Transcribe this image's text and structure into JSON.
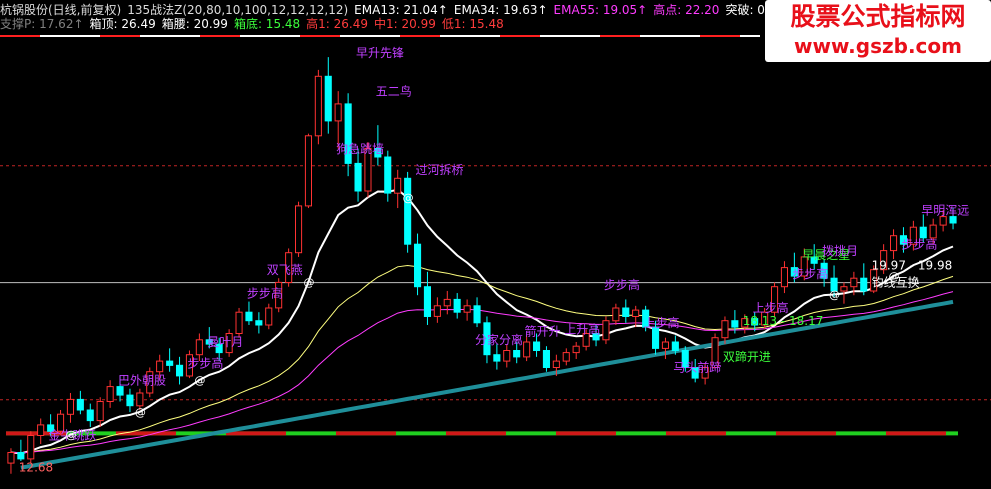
{
  "header": {
    "row1": [
      {
        "text": "杭锅股份(日线,前复权)",
        "color": "#dcdcdc"
      },
      {
        "text": "135战法Z(20,80,10,100,12,12,12,12)",
        "color": "#dcdcdc"
      },
      {
        "text": "EMA13: 21.04↑",
        "color": "#ffffff"
      },
      {
        "text": "EMA34: 19.63↑",
        "color": "#ffffff"
      },
      {
        "text": "EMA55: 19.05↑",
        "color": "#ff3cff"
      },
      {
        "text": "高点: 22.20",
        "color": "#ff3cff"
      },
      {
        "text": "突破: 0.00",
        "color": "#ffffff"
      }
    ],
    "row2": [
      {
        "text": "支撑P: 17.62↑",
        "color": "#808080"
      },
      {
        "text": "箱顶: 26.49",
        "color": "#ffffff"
      },
      {
        "text": "箱腰: 20.99",
        "color": "#ffffff"
      },
      {
        "text": "箱底: 15.48",
        "color": "#3cff3c"
      },
      {
        "text": "高1: 26.49",
        "color": "#ff3c3c"
      },
      {
        "text": "中1: 20.99",
        "color": "#ff3c3c"
      },
      {
        "text": "低1: 15.48",
        "color": "#ff3c3c"
      }
    ]
  },
  "watermark": {
    "line1": "股票公式指标网",
    "line2": "www.gszb.com"
  },
  "colors": {
    "up": "#ff3232",
    "down": "#00ffff",
    "ema13": "#ffffff",
    "ema34": "#ffff80",
    "ema55": "#ff3cff",
    "long": "#1f8f9a",
    "label": "#c040ff",
    "label_alt": "#ffff00"
  },
  "chart_data": {
    "type": "candlestick",
    "ylim": [
      11.8,
      32.5
    ],
    "x_count": 96,
    "ohlc": [
      [
        12.5,
        13.2,
        12.0,
        13.0
      ],
      [
        13.0,
        13.6,
        12.6,
        12.7
      ],
      [
        12.7,
        14.0,
        12.5,
        13.8
      ],
      [
        13.8,
        14.6,
        13.4,
        14.3
      ],
      [
        14.3,
        14.8,
        13.8,
        14.0
      ],
      [
        14.0,
        15.0,
        13.8,
        14.8
      ],
      [
        14.8,
        15.8,
        14.4,
        15.5
      ],
      [
        15.5,
        15.9,
        14.8,
        15.0
      ],
      [
        15.0,
        15.3,
        14.2,
        14.5
      ],
      [
        14.5,
        15.6,
        14.2,
        15.4
      ],
      [
        15.4,
        16.4,
        15.1,
        16.1
      ],
      [
        16.1,
        16.6,
        15.4,
        15.7
      ],
      [
        15.7,
        16.0,
        14.9,
        15.2
      ],
      [
        15.2,
        16.0,
        15.0,
        15.8
      ],
      [
        15.8,
        17.0,
        15.6,
        16.8
      ],
      [
        16.8,
        17.6,
        16.4,
        17.3
      ],
      [
        17.3,
        17.9,
        16.8,
        17.1
      ],
      [
        17.1,
        17.5,
        16.2,
        16.6
      ],
      [
        16.6,
        17.8,
        16.5,
        17.6
      ],
      [
        17.6,
        18.6,
        17.3,
        18.3
      ],
      [
        18.3,
        18.9,
        17.9,
        18.1
      ],
      [
        18.1,
        18.4,
        17.3,
        17.7
      ],
      [
        17.7,
        18.8,
        17.5,
        18.6
      ],
      [
        18.6,
        19.8,
        18.4,
        19.6
      ],
      [
        19.6,
        20.1,
        19.0,
        19.2
      ],
      [
        19.2,
        19.6,
        18.6,
        19.0
      ],
      [
        19.0,
        20.0,
        18.8,
        19.8
      ],
      [
        19.8,
        21.2,
        19.6,
        21.0
      ],
      [
        21.0,
        22.6,
        20.8,
        22.4
      ],
      [
        22.4,
        24.8,
        22.2,
        24.6
      ],
      [
        24.6,
        28.0,
        24.5,
        27.9
      ],
      [
        27.9,
        31.0,
        27.5,
        30.7
      ],
      [
        30.7,
        31.6,
        28.0,
        28.6
      ],
      [
        28.6,
        30.0,
        27.3,
        29.4
      ],
      [
        29.4,
        29.9,
        26.0,
        26.6
      ],
      [
        26.6,
        27.3,
        24.8,
        25.3
      ],
      [
        25.3,
        27.6,
        25.0,
        27.3
      ],
      [
        27.3,
        28.4,
        26.5,
        26.9
      ],
      [
        26.9,
        27.2,
        24.8,
        25.2
      ],
      [
        25.2,
        26.3,
        24.5,
        25.9
      ],
      [
        25.9,
        26.2,
        22.4,
        22.8
      ],
      [
        22.8,
        23.3,
        20.4,
        20.8
      ],
      [
        20.8,
        21.5,
        19.0,
        19.4
      ],
      [
        19.4,
        20.3,
        19.1,
        19.9
      ],
      [
        19.9,
        20.6,
        19.5,
        20.2
      ],
      [
        20.2,
        20.5,
        19.3,
        19.6
      ],
      [
        19.6,
        20.2,
        19.2,
        19.9
      ],
      [
        19.9,
        20.3,
        18.9,
        19.1
      ],
      [
        19.1,
        19.4,
        17.2,
        17.6
      ],
      [
        17.6,
        18.1,
        16.9,
        17.3
      ],
      [
        17.3,
        18.1,
        17.0,
        17.8
      ],
      [
        17.8,
        18.2,
        17.2,
        17.5
      ],
      [
        17.5,
        18.5,
        17.3,
        18.2
      ],
      [
        18.2,
        18.6,
        17.5,
        17.8
      ],
      [
        17.8,
        18.0,
        16.8,
        17.0
      ],
      [
        17.0,
        17.6,
        16.6,
        17.3
      ],
      [
        17.3,
        17.9,
        17.1,
        17.7
      ],
      [
        17.7,
        18.2,
        17.4,
        18.0
      ],
      [
        18.0,
        18.8,
        17.8,
        18.6
      ],
      [
        18.6,
        19.0,
        18.0,
        18.3
      ],
      [
        18.3,
        19.4,
        18.1,
        19.2
      ],
      [
        19.2,
        20.0,
        19.0,
        19.8
      ],
      [
        19.8,
        20.2,
        19.1,
        19.4
      ],
      [
        19.4,
        19.9,
        18.9,
        19.7
      ],
      [
        19.7,
        19.9,
        18.7,
        18.9
      ],
      [
        18.9,
        19.2,
        17.6,
        17.9
      ],
      [
        17.9,
        18.4,
        17.4,
        18.2
      ],
      [
        18.2,
        18.5,
        17.6,
        17.8
      ],
      [
        17.8,
        18.0,
        16.8,
        17.0
      ],
      [
        17.0,
        17.4,
        16.3,
        16.5
      ],
      [
        16.5,
        17.2,
        16.2,
        17.0
      ],
      [
        17.0,
        18.6,
        16.9,
        18.4
      ],
      [
        18.4,
        19.4,
        18.1,
        19.2
      ],
      [
        19.2,
        19.7,
        18.6,
        18.9
      ],
      [
        18.9,
        19.5,
        18.6,
        19.3
      ],
      [
        19.3,
        19.6,
        18.7,
        19.0
      ],
      [
        19.0,
        19.8,
        18.8,
        19.6
      ],
      [
        19.6,
        21.0,
        19.4,
        20.8
      ],
      [
        20.8,
        22.0,
        20.5,
        21.7
      ],
      [
        21.7,
        22.4,
        21.0,
        21.3
      ],
      [
        21.3,
        22.6,
        21.1,
        22.2
      ],
      [
        22.2,
        22.8,
        21.6,
        21.9
      ],
      [
        21.9,
        22.1,
        20.8,
        21.2
      ],
      [
        21.2,
        21.8,
        20.3,
        20.6
      ],
      [
        20.6,
        21.0,
        20.0,
        20.8
      ],
      [
        20.8,
        21.5,
        20.4,
        21.2
      ],
      [
        21.2,
        21.9,
        20.4,
        20.6
      ],
      [
        20.6,
        21.8,
        20.5,
        21.6
      ],
      [
        21.6,
        22.8,
        21.4,
        22.5
      ],
      [
        22.5,
        23.5,
        22.1,
        23.2
      ],
      [
        23.2,
        23.6,
        22.4,
        22.8
      ],
      [
        22.8,
        23.9,
        22.5,
        23.6
      ],
      [
        23.6,
        24.2,
        22.9,
        23.1
      ],
      [
        23.1,
        24.0,
        22.8,
        23.7
      ],
      [
        23.7,
        24.4,
        23.4,
        24.1
      ],
      [
        24.1,
        24.5,
        23.5,
        23.8
      ]
    ],
    "box_levels": [
      26.49,
      20.99,
      15.48
    ],
    "annotations": [
      {
        "i": 6,
        "price": 13.6,
        "text": "金牛跳跃",
        "color": "#c040ff"
      },
      {
        "i": 14,
        "price": 16.2,
        "text": "巴外朝股",
        "color": "#c040ff"
      },
      {
        "i": 22,
        "price": 17.0,
        "text": "步步高",
        "color": "#c040ff"
      },
      {
        "i": 25,
        "price": 18.0,
        "text": "曼叶月",
        "color": "#c040ff"
      },
      {
        "i": 30,
        "price": 20.3,
        "text": "步步高",
        "color": "#c040ff"
      },
      {
        "i": 32,
        "price": 21.4,
        "text": "双飞燕",
        "color": "#c040ff"
      },
      {
        "i": 40,
        "price": 27.1,
        "text": "狗急跳墙",
        "color": "#c040ff"
      },
      {
        "i": 42,
        "price": 31.6,
        "text": "早升先锋",
        "color": "#c040ff"
      },
      {
        "i": 45,
        "price": 29.8,
        "text": "五二鸟",
        "color": "#c040ff"
      },
      {
        "i": 50,
        "price": 26.1,
        "text": "过河拆桥",
        "color": "#c040ff"
      },
      {
        "i": 57,
        "price": 18.1,
        "text": "分家分离",
        "color": "#c040ff"
      },
      {
        "i": 63,
        "price": 18.5,
        "text": "箭开升",
        "color": "#c040ff"
      },
      {
        "i": 67,
        "price": 18.6,
        "text": "上升高",
        "color": "#c040ff"
      },
      {
        "i": 72,
        "price": 20.7,
        "text": "步步高",
        "color": "#c040ff"
      },
      {
        "i": 77,
        "price": 18.9,
        "text": "上步高",
        "color": "#c040ff"
      },
      {
        "i": 80,
        "price": 16.8,
        "text": "马头前蹄",
        "color": "#c040ff"
      },
      {
        "i": 86,
        "price": 17.3,
        "text": "双蹄开进",
        "color": "#3cff3c"
      },
      {
        "i": 88,
        "price": 19.0,
        "text": "18.13 - 18.17",
        "color": "#3cff3c"
      },
      {
        "i": 90,
        "price": 19.6,
        "text": "上步高",
        "color": "#c040ff"
      },
      {
        "i": 94,
        "price": 21.2,
        "text": "步步高",
        "color": "#c040ff"
      },
      {
        "i": 96,
        "price": 22.1,
        "text": "早晨之星",
        "color": "#3cff3c"
      },
      {
        "i": 98,
        "price": 22.3,
        "text": "拨挑月",
        "color": "#c040ff"
      },
      {
        "i": 104,
        "price": 21.6,
        "text": "19.97 - 19.98",
        "color": "#ffffff"
      },
      {
        "i": 104,
        "price": 20.8,
        "text": "钓线互换",
        "color": "#ffffff"
      },
      {
        "i": 107,
        "price": 22.6,
        "text": "步步高",
        "color": "#c040ff"
      },
      {
        "i": 110,
        "price": 24.2,
        "text": "早明浑远",
        "color": "#c040ff"
      },
      {
        "i": 2,
        "price": 12.1,
        "text": "12.68",
        "color": "#ff6060"
      }
    ]
  }
}
